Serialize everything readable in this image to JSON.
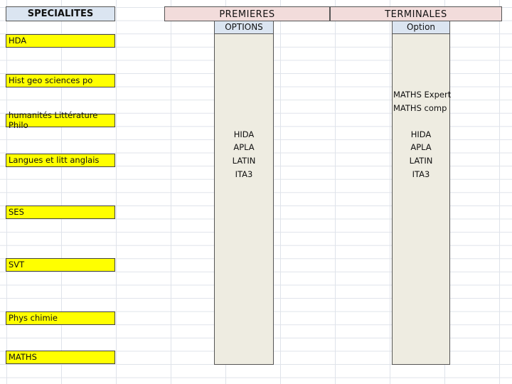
{
  "headers": {
    "specialites": "SPECIALITES",
    "premieres": "PREMIERES",
    "terminales": "TERMINALES",
    "premieres_options": "OPTIONS",
    "terminales_option": "Option"
  },
  "specialites": [
    "HDA",
    "Hist geo sciences po",
    "humanités Littérature Philo",
    "Langues et litt anglais",
    "SES",
    "SVT",
    "Phys chimie",
    "MATHS"
  ],
  "premieres_options": [
    "HIDA",
    "APLA",
    "LATIN",
    "ITA3"
  ],
  "terminales_extra": [
    "MATHS Expert",
    "MATHS comp"
  ],
  "terminales_options": [
    "HIDA",
    "APLA",
    "LATIN",
    "ITA3"
  ],
  "colors": {
    "header_blue": "#dbe5f1",
    "header_pink": "#f2dcdb",
    "highlight_yellow": "#ffff00",
    "column_beige": "#eeece1"
  }
}
